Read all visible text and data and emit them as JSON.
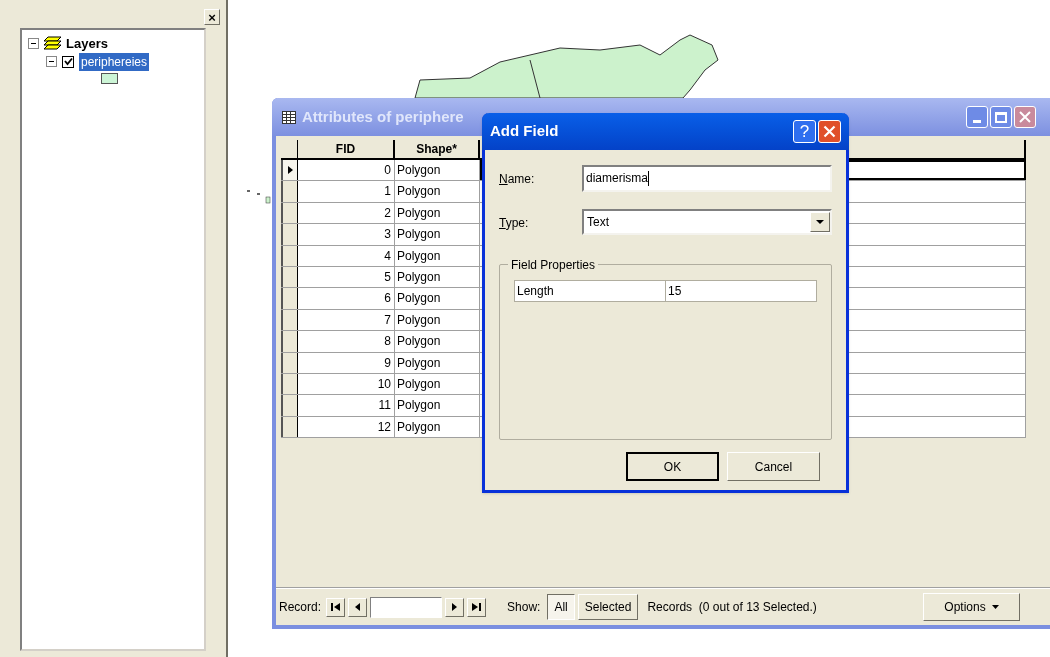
{
  "toc": {
    "close": "×",
    "root": {
      "label": "Layers",
      "expanded": true
    },
    "layers": [
      {
        "name": "periphereies",
        "checked": true,
        "selected": true,
        "expanded": true,
        "color": "#ccf5d6"
      }
    ]
  },
  "attributes_window": {
    "title": "Attributes of periphere",
    "columns": [
      "FID",
      "Shape*"
    ],
    "rows": [
      {
        "fid": "0",
        "shape": "Polygon",
        "current": true
      },
      {
        "fid": "1",
        "shape": "Polygon",
        "current": false
      },
      {
        "fid": "2",
        "shape": "Polygon",
        "current": false
      },
      {
        "fid": "3",
        "shape": "Polygon",
        "current": false
      },
      {
        "fid": "4",
        "shape": "Polygon",
        "current": false
      },
      {
        "fid": "5",
        "shape": "Polygon",
        "current": false
      },
      {
        "fid": "6",
        "shape": "Polygon",
        "current": false
      },
      {
        "fid": "7",
        "shape": "Polygon",
        "current": false
      },
      {
        "fid": "8",
        "shape": "Polygon",
        "current": false
      },
      {
        "fid": "9",
        "shape": "Polygon",
        "current": false
      },
      {
        "fid": "10",
        "shape": "Polygon",
        "current": false
      },
      {
        "fid": "11",
        "shape": "Polygon",
        "current": false
      },
      {
        "fid": "12",
        "shape": "Polygon",
        "current": false
      }
    ],
    "footer": {
      "record_label": "Record:",
      "show_label": "Show:",
      "show_options": [
        {
          "label": "All",
          "selected": true
        },
        {
          "label": "Selected",
          "selected": false
        }
      ],
      "records_text": "Records  (0 out of 13 Selected.)",
      "options_button": "Options"
    }
  },
  "add_field_dialog": {
    "title": "Add Field",
    "help": "?",
    "name_label": "Name:",
    "name_value": "diamerisma",
    "type_label": "Type:",
    "type_value": "Text",
    "group_title": "Field Properties",
    "properties": [
      {
        "name": "Length",
        "value": "15"
      }
    ],
    "buttons": [
      {
        "label": "OK",
        "default": true
      },
      {
        "label": "Cancel",
        "default": false
      }
    ]
  }
}
